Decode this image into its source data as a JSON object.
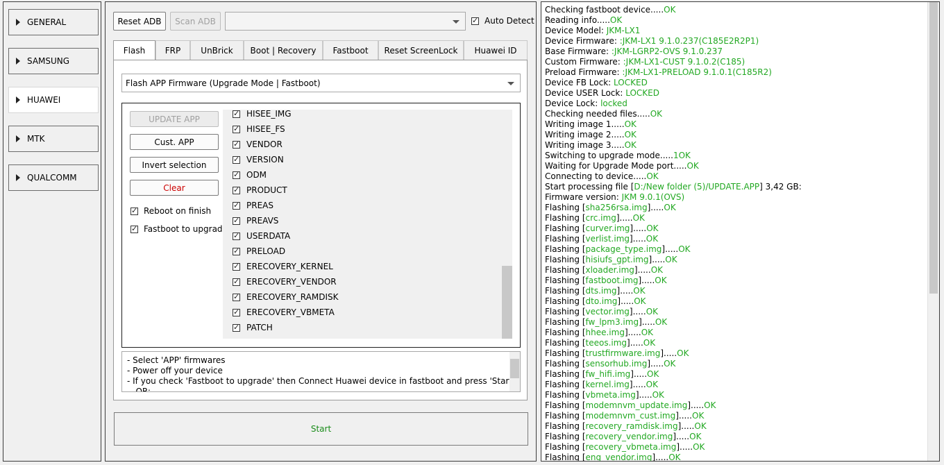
{
  "sidebar": {
    "items": [
      {
        "label": "GENERAL",
        "active": false
      },
      {
        "label": "SAMSUNG",
        "active": false
      },
      {
        "label": "HUAWEI",
        "active": true
      },
      {
        "label": "MTK",
        "active": false
      },
      {
        "label": "QUALCOMM",
        "active": false
      }
    ]
  },
  "toolbar": {
    "reset_adb": "Reset ADB",
    "scan_adb": "Scan ADB",
    "device_select": "",
    "auto_detect": "Auto Detect"
  },
  "tabs": [
    {
      "label": "Flash",
      "active": true
    },
    {
      "label": "FRP",
      "active": false
    },
    {
      "label": "UnBrick",
      "active": false
    },
    {
      "label": "Boot | Recovery",
      "active": false
    },
    {
      "label": "Fastboot",
      "active": false
    },
    {
      "label": "Reset ScreenLock",
      "active": false
    },
    {
      "label": "Huawei ID",
      "active": false
    }
  ],
  "flash": {
    "mode_select": "Flash APP Firmware (Upgrade Mode | Fastboot)",
    "update_app": "UPDATE APP",
    "cust_app": "Cust. APP",
    "invert_selection": "Invert selection",
    "clear": "Clear",
    "reboot_on_finish": "Reboot on finish",
    "fastboot_to_upgrade": "Fastboot to upgrade",
    "partitions": [
      "HISEE_IMG",
      "HISEE_FS",
      "VENDOR",
      "VERSION",
      "ODM",
      "PRODUCT",
      "PREAS",
      "PREAVS",
      "USERDATA",
      "PRELOAD",
      "ERECOVERY_KERNEL",
      "ERECOVERY_VENDOR",
      "ERECOVERY_RAMDISK",
      "ERECOVERY_VBMETA",
      "PATCH"
    ],
    "notes": [
      "- Select 'APP' firmwares",
      "- Power off your device",
      "- If you check 'Fastboot to upgrade' then Connect Huawei device in fastboot and press 'Start'",
      "-- OR:"
    ],
    "start": "Start"
  },
  "colors": {
    "ok_green": "#22a822",
    "clear_red": "#cc0000"
  },
  "log": [
    {
      "t": "Checking fastboot device.....",
      "g": "OK",
      "s": ""
    },
    {
      "t": "Reading info.....",
      "g": "OK",
      "s": ""
    },
    {
      "t": "Device Model: ",
      "g": "JKM-LX1",
      "s": ""
    },
    {
      "t": "Device Firmware: ",
      "g": ":JKM-LX1 9.1.0.237(C185E2R2P1)",
      "s": ""
    },
    {
      "t": "Base Firmware: ",
      "g": ":JKM-LGRP2-OVS 9.1.0.237",
      "s": ""
    },
    {
      "t": "Custom Firmware: ",
      "g": ":JKM-LX1-CUST 9.1.0.2(C185)",
      "s": ""
    },
    {
      "t": "Preload Firmware: ",
      "g": ":JKM-LX1-PRELOAD 9.1.0.1(C185R2)",
      "s": ""
    },
    {
      "t": "Device FB Lock: ",
      "g": "LOCKED",
      "s": ""
    },
    {
      "t": "Device USER Lock: ",
      "g": "LOCKED",
      "s": ""
    },
    {
      "t": "Device Lock: ",
      "g": "locked",
      "s": ""
    },
    {
      "t": "Checking needed files.....",
      "g": "OK",
      "s": ""
    },
    {
      "t": "Writing image 1.....",
      "g": "OK",
      "s": ""
    },
    {
      "t": "Writing image 2.....",
      "g": "OK",
      "s": ""
    },
    {
      "t": "Writing image 3.....",
      "g": "OK",
      "s": ""
    },
    {
      "t": "Switching to upgrade mode.....",
      "g": "1OK",
      "s": ""
    },
    {
      "t": "Waiting for Upgrade Mode port.....",
      "g": "OK",
      "s": ""
    },
    {
      "t": "Connecting to device.....",
      "g": "OK",
      "s": ""
    },
    {
      "t": "Start processing file [",
      "g": "D:/New folder (5)/UPDATE.APP",
      "s": "] 3,42 GB:"
    },
    {
      "t": "Firmware version: ",
      "g": "JKM 9.0.1(OVS)",
      "s": ""
    },
    {
      "t": "Flashing [",
      "g": "sha256rsa.img",
      "s": "].....",
      "ok": "OK"
    },
    {
      "t": "Flashing [",
      "g": "crc.img",
      "s": "].....",
      "ok": "OK"
    },
    {
      "t": "Flashing [",
      "g": "curver.img",
      "s": "].....",
      "ok": "OK"
    },
    {
      "t": "Flashing [",
      "g": "verlist.img",
      "s": "].....",
      "ok": "OK"
    },
    {
      "t": "Flashing [",
      "g": "package_type.img",
      "s": "].....",
      "ok": "OK"
    },
    {
      "t": "Flashing [",
      "g": "hisiufs_gpt.img",
      "s": "].....",
      "ok": "OK"
    },
    {
      "t": "Flashing [",
      "g": "xloader.img",
      "s": "].....",
      "ok": "OK"
    },
    {
      "t": "Flashing [",
      "g": "fastboot.img",
      "s": "].....",
      "ok": "OK"
    },
    {
      "t": "Flashing [",
      "g": "dts.img",
      "s": "].....",
      "ok": "OK"
    },
    {
      "t": "Flashing [",
      "g": "dto.img",
      "s": "].....",
      "ok": "OK"
    },
    {
      "t": "Flashing [",
      "g": "vector.img",
      "s": "].....",
      "ok": "OK"
    },
    {
      "t": "Flashing [",
      "g": "fw_lpm3.img",
      "s": "].....",
      "ok": "OK"
    },
    {
      "t": "Flashing [",
      "g": "hhee.img",
      "s": "].....",
      "ok": "OK"
    },
    {
      "t": "Flashing [",
      "g": "teeos.img",
      "s": "].....",
      "ok": "OK"
    },
    {
      "t": "Flashing [",
      "g": "trustfirmware.img",
      "s": "].....",
      "ok": "OK"
    },
    {
      "t": "Flashing [",
      "g": "sensorhub.img",
      "s": "].....",
      "ok": "OK"
    },
    {
      "t": "Flashing [",
      "g": "fw_hifi.img",
      "s": "].....",
      "ok": "OK"
    },
    {
      "t": "Flashing [",
      "g": "kernel.img",
      "s": "].....",
      "ok": "OK"
    },
    {
      "t": "Flashing [",
      "g": "vbmeta.img",
      "s": "].....",
      "ok": "OK"
    },
    {
      "t": "Flashing [",
      "g": "modemnvm_update.img",
      "s": "].....",
      "ok": "OK"
    },
    {
      "t": "Flashing [",
      "g": "modemnvm_cust.img",
      "s": "].....",
      "ok": "OK"
    },
    {
      "t": "Flashing [",
      "g": "recovery_ramdisk.img",
      "s": "].....",
      "ok": "OK"
    },
    {
      "t": "Flashing [",
      "g": "recovery_vendor.img",
      "s": "].....",
      "ok": "OK"
    },
    {
      "t": "Flashing [",
      "g": "recovery_vbmeta.img",
      "s": "].....",
      "ok": "OK"
    },
    {
      "t": "Flashing [",
      "g": "eng_vendor.img",
      "s": "].....",
      "ok": "OK"
    }
  ]
}
